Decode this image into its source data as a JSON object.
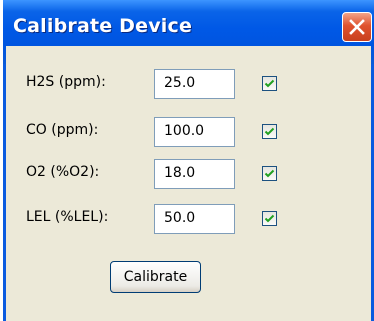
{
  "window": {
    "title": "Calibrate Device",
    "close_icon": "close-icon"
  },
  "fields": [
    {
      "label": "H2S (ppm):",
      "value": "25.0",
      "checked": true
    },
    {
      "label": "CO (ppm):",
      "value": "100.0",
      "checked": true
    },
    {
      "label": "O2 (%O2):",
      "value": "18.0",
      "checked": true
    },
    {
      "label": "LEL (%LEL):",
      "value": "50.0",
      "checked": true
    }
  ],
  "calibrate_label": "Calibrate",
  "colors": {
    "title_bar": "#0058e6",
    "client_bg": "#ece9d8",
    "close_button": "#e0522e",
    "check_mark": "#21a121"
  }
}
